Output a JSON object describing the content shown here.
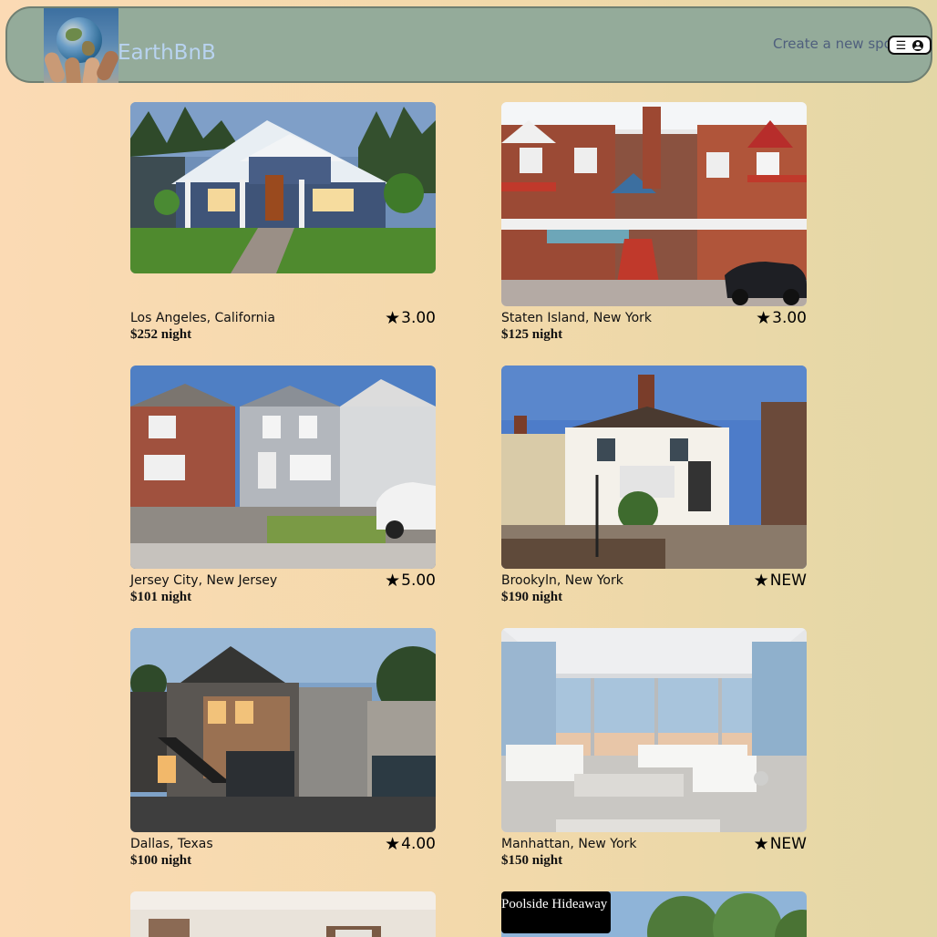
{
  "header": {
    "brand": "EarthBnB",
    "create_link": "Create a new spot"
  },
  "spots": [
    {
      "location": "Los Angeles, California",
      "price": "$252 night",
      "rating": "3.00"
    },
    {
      "location": "Staten Island, New York",
      "price": "$125 night",
      "rating": "3.00"
    },
    {
      "location": "Jersey City, New Jersey",
      "price": "$101 night",
      "rating": "5.00"
    },
    {
      "location": "Brookyln, New York",
      "price": "$190 night",
      "rating": "NEW"
    },
    {
      "location": "Dallas, Texas",
      "price": "$100 night",
      "rating": "4.00"
    },
    {
      "location": "Manhattan, New York",
      "price": "$150 night",
      "rating": "NEW"
    }
  ],
  "tooltip": {
    "text": "Poolside Hideaway"
  },
  "colors": {
    "header_bg": "#94ab9a",
    "brand": "#b8d3f0",
    "link": "#4f5f7d",
    "page_bg": "#fbdab4"
  }
}
